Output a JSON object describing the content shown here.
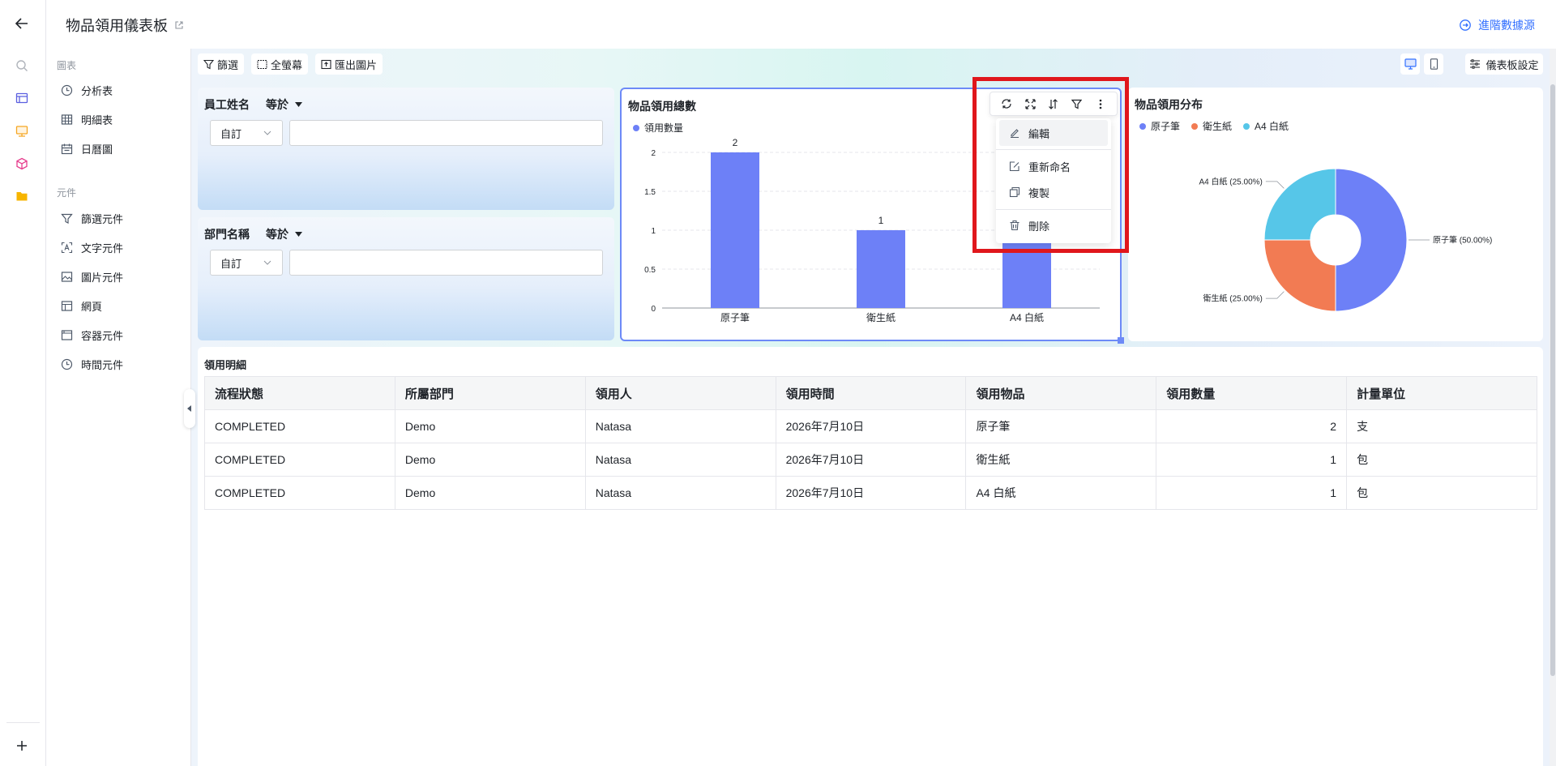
{
  "header": {
    "title": "物品領用儀表板",
    "advanced_datasource": "進階數據源"
  },
  "sidebar": {
    "charts_section": "圖表",
    "chart_items": [
      {
        "label": "分析表",
        "icon": "clock-icon"
      },
      {
        "label": "明細表",
        "icon": "table-icon"
      },
      {
        "label": "日曆圖",
        "icon": "calendar-icon"
      }
    ],
    "components_section": "元件",
    "component_items": [
      {
        "label": "篩選元件",
        "icon": "filter-icon"
      },
      {
        "label": "文字元件",
        "icon": "text-icon"
      },
      {
        "label": "圖片元件",
        "icon": "image-icon"
      },
      {
        "label": "網頁",
        "icon": "webpage-icon"
      },
      {
        "label": "容器元件",
        "icon": "container-icon"
      },
      {
        "label": "時間元件",
        "icon": "time-icon"
      }
    ]
  },
  "toolbar": {
    "filter": "篩選",
    "fullscreen": "全螢幕",
    "export_image": "匯出圖片",
    "dashboard_settings": "儀表板設定"
  },
  "filters": [
    {
      "label": "員工姓名",
      "operator": "等於",
      "mode": "自訂",
      "value": ""
    },
    {
      "label": "部門名稱",
      "operator": "等於",
      "mode": "自訂",
      "value": ""
    }
  ],
  "bar_chart_card": {
    "title": "物品領用總數",
    "legend": "領用數量",
    "menu": {
      "edit": "編輯",
      "rename": "重新命名",
      "copy": "複製",
      "delete": "刪除"
    }
  },
  "pie_chart_card": {
    "title": "物品領用分布"
  },
  "chart_data": [
    {
      "type": "bar",
      "title": "物品領用總數",
      "categories": [
        "原子筆",
        "衛生紙",
        "A4 白紙"
      ],
      "series": [
        {
          "name": "領用數量",
          "values": [
            2,
            1,
            1
          ]
        }
      ],
      "ylim": [
        0,
        2
      ],
      "yticks": [
        "0",
        "0.5",
        "1",
        "1.5",
        "2"
      ],
      "grid": true,
      "legend_position": "top-left",
      "color": "#6d80f7"
    },
    {
      "type": "pie",
      "title": "物品領用分布",
      "labels": [
        "原子筆",
        "衛生紙",
        "A4 白紙"
      ],
      "values": [
        2,
        1,
        1
      ],
      "slice_labels": [
        "原子筆 (50.00%)",
        "衛生紙 (25.00%)",
        "A4 白紙 (25.00%)"
      ],
      "colors": [
        "#6d80f7",
        "#f27b53",
        "#56c6e8"
      ],
      "donut": true,
      "legend_position": "top-left"
    }
  ],
  "table": {
    "title": "領用明細",
    "columns": [
      "流程狀態",
      "所屬部門",
      "領用人",
      "領用時間",
      "領用物品",
      "領用數量",
      "計量單位"
    ],
    "rows": [
      [
        "COMPLETED",
        "Demo",
        "Natasa",
        "2026年7月10日",
        "原子筆",
        "2",
        "支"
      ],
      [
        "COMPLETED",
        "Demo",
        "Natasa",
        "2026年7月10日",
        "衛生紙",
        "1",
        "包"
      ],
      [
        "COMPLETED",
        "Demo",
        "Natasa",
        "2026年7月10日",
        "A4 白紙",
        "1",
        "包"
      ]
    ]
  },
  "colors": {
    "accent": "#3370ff",
    "bar": "#6d80f7",
    "highlight": "#e0171c"
  }
}
